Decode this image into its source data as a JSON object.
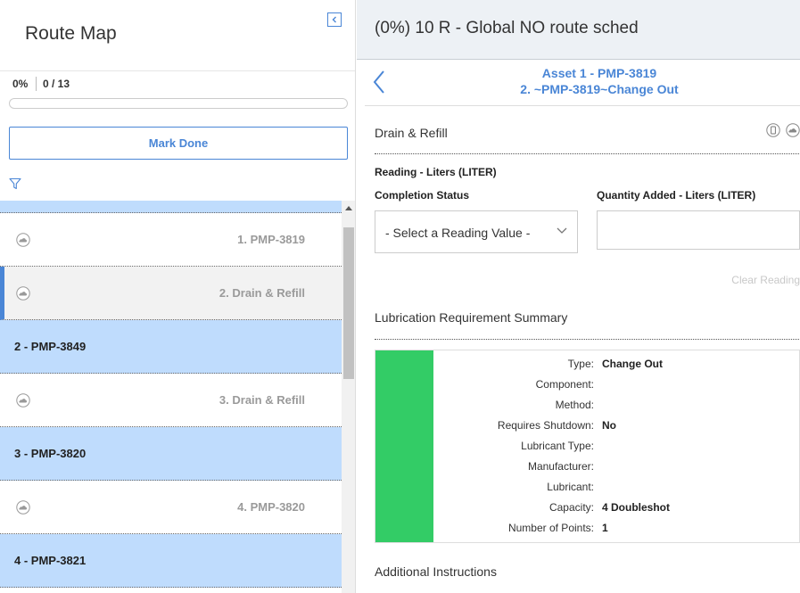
{
  "left_panel": {
    "title": "Route Map",
    "progress": {
      "percent_label": "0%",
      "count_label": "0 / 13",
      "fraction": 0.0
    },
    "mark_done_label": "Mark Done",
    "items": [
      {
        "kind": "step",
        "label": "1. PMP-3819",
        "active": false
      },
      {
        "kind": "step",
        "label": "2. Drain & Refill",
        "active": true
      },
      {
        "kind": "asset",
        "label": "2 - PMP-3849"
      },
      {
        "kind": "step",
        "label": "3. Drain & Refill",
        "active": false
      },
      {
        "kind": "asset",
        "label": "3 - PMP-3820"
      },
      {
        "kind": "step",
        "label": "4. PMP-3820",
        "active": false
      },
      {
        "kind": "asset",
        "label": "4 - PMP-3821"
      }
    ]
  },
  "right_panel": {
    "title": "(0%) 10 R - Global NO route sched",
    "breadcrumb": {
      "line1": "Asset 1 - PMP-3819",
      "line2": "2. ~PMP-3819~Change Out"
    },
    "section_title": "Drain & Refill",
    "reading_label": "Reading - Liters (LITER)",
    "completion_status_label": "Completion Status",
    "completion_status_value": "- Select a Reading Value -",
    "quantity_added_label": "Quantity Added - Liters (LITER)",
    "quantity_added_value": "",
    "clear_reading_label": "Clear Reading",
    "summary_title": "Lubrication Requirement Summary",
    "summary_color": "#33cc66",
    "summary": [
      {
        "label": "Type:",
        "value": "Change Out"
      },
      {
        "label": "Component:",
        "value": ""
      },
      {
        "label": "Method:",
        "value": ""
      },
      {
        "label": "Requires Shutdown:",
        "value": "No"
      },
      {
        "label": "Lubricant Type:",
        "value": ""
      },
      {
        "label": "Manufacturer:",
        "value": ""
      },
      {
        "label": "Lubricant:",
        "value": ""
      },
      {
        "label": "Capacity:",
        "value": "4 Doubleshot"
      },
      {
        "label": "Number of Points:",
        "value": "1"
      }
    ],
    "additional_instructions_title": "Additional Instructions"
  },
  "colors": {
    "accent": "#4a86d6",
    "asset_row_bg": "#bfdcfd",
    "header_bg": "#edf1f5"
  }
}
